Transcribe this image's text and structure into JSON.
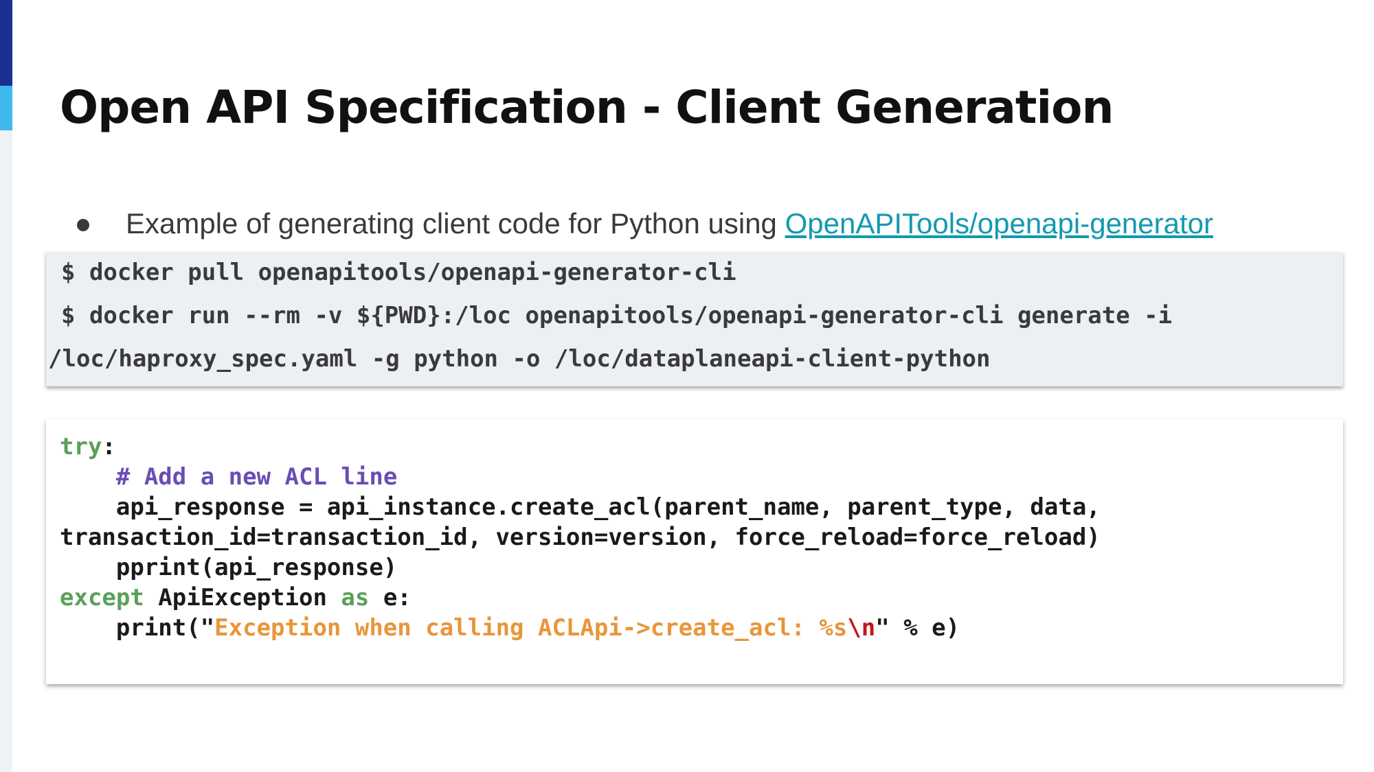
{
  "slide": {
    "title": "Open API Specification - Client Generation",
    "bullet_text": "Example of generating client code for Python using ",
    "bullet_link": "OpenAPITools/openapi-generator",
    "link_color": "#129ab0"
  },
  "shell": {
    "lines": [
      "$ docker pull openapitools/openapi-generator-cli",
      "$ docker run --rm -v ${PWD}:/loc openapitools/openapi-generator-cli generate -i",
      "/loc/haproxy_spec.yaml -g python -o /loc/dataplaneapi-client-python"
    ]
  },
  "code": {
    "l1_kw": "try",
    "l1_rest": ":",
    "l2_indent": "    ",
    "l2_comment": "# Add a new ACL line",
    "l3": "    api_response = api_instance.create_acl(parent_name, parent_type, data,",
    "l4": "transaction_id=transaction_id, version=version, force_reload=force_reload)",
    "l5": "    pprint(api_response)",
    "l6_kw1": "except",
    "l6_mid": " ApiException ",
    "l6_kw2": "as",
    "l6_end": " e:",
    "l7_pre": "    print(\"",
    "l7_str": "Exception when calling ACLApi->create_acl: %s",
    "l7_esc": "\\n",
    "l7_post": "\" % e)",
    "colors": {
      "keyword": "#5aa05a",
      "comment": "#6a4db5",
      "string": "#e8963a",
      "escape": "#c4141a"
    }
  },
  "theme": {
    "accent_dark": "#1b2f8f",
    "accent_light": "#3fb8ee"
  }
}
